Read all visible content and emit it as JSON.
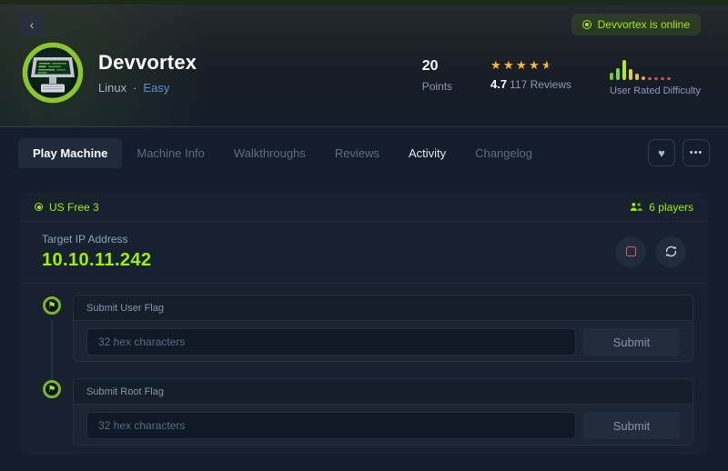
{
  "header": {
    "back_icon": "‹",
    "online_badge": "Devvortex is online",
    "machine_name": "Devvortex",
    "os": "Linux",
    "separator": "·",
    "difficulty": "Easy",
    "stats": {
      "points_value": "20",
      "points_label": "Points",
      "stars": 4.5,
      "rating_value": "4.7",
      "reviews_label": "117 Reviews",
      "difficulty_label": "User Rated Difficulty",
      "difficulty_chart": {
        "type": "bar",
        "values": [
          8,
          13,
          22,
          12,
          7,
          4,
          3,
          3,
          3,
          3
        ],
        "colors": [
          "#71c832",
          "#7ed930",
          "#b4e42c",
          "#dcd32e",
          "#e4c43a",
          "#e0a93c",
          "#cc5c52",
          "#c45050",
          "#c45050",
          "#c45050"
        ]
      }
    }
  },
  "tabs": [
    {
      "label": "Play Machine",
      "active": true
    },
    {
      "label": "Machine Info"
    },
    {
      "label": "Walkthroughs"
    },
    {
      "label": "Reviews"
    },
    {
      "label": "Activity"
    },
    {
      "label": "Changelog"
    }
  ],
  "tab_actions": {
    "favorite_icon": "♥",
    "more_icon": "•••"
  },
  "machine_panel": {
    "server_label": "US Free 3",
    "players_label": "6 players",
    "ip_label": "Target IP Address",
    "ip_value": "10.10.11.242",
    "flags": [
      {
        "flag_icon": "⚑",
        "title": "Submit User Flag",
        "placeholder": "32 hex characters",
        "submit_label": "Submit"
      },
      {
        "flag_icon": "⚑",
        "title": "Submit Root Flag",
        "placeholder": "32 hex characters",
        "submit_label": "Submit"
      }
    ]
  },
  "colors": {
    "accent_green": "#9fef00",
    "star_amber": "#ffb62e",
    "stop_red": "#e85a5a",
    "easy_blue": "#5d8edd"
  }
}
